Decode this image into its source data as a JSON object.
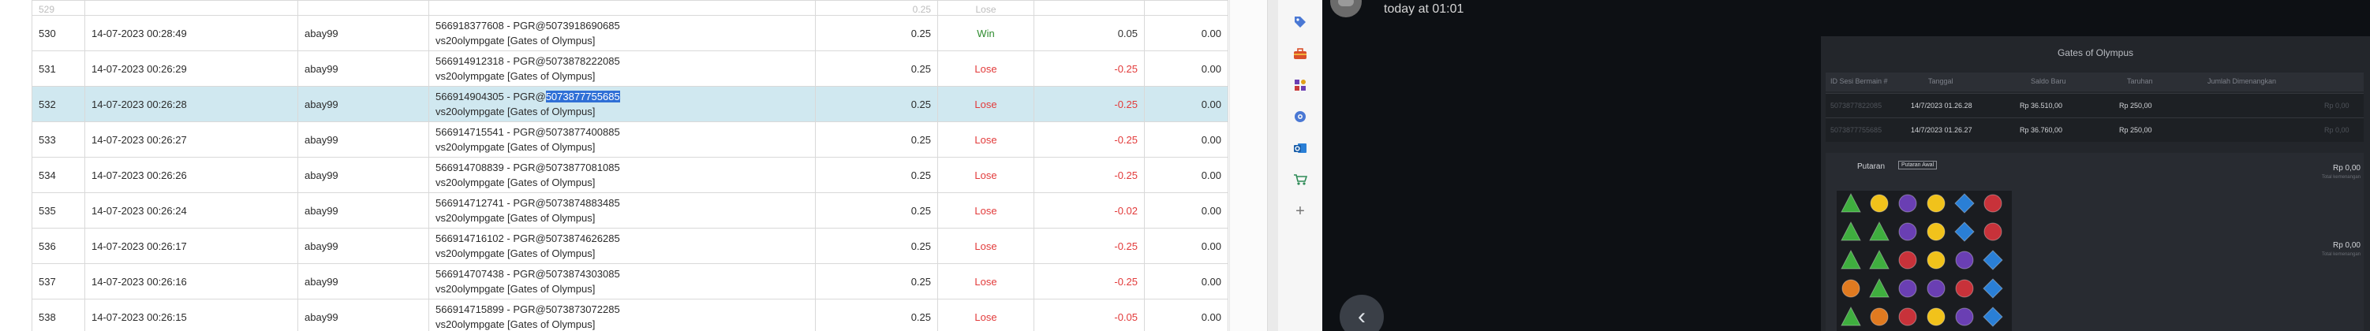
{
  "table": {
    "partial_row": {
      "no": "529",
      "date": "",
      "user": "",
      "amount": "0.25",
      "result": "Lose",
      "winloss": "",
      "bal": ""
    },
    "rows": [
      {
        "no": "530",
        "date": "14-07-2023 00:28:49",
        "user": "abay99",
        "tx1": "566918377608 - PGR@5073918690685",
        "tx2": "vs20olympgate [Gates of Olympus]",
        "amount": "0.25",
        "result": "Win",
        "winloss": "0.05",
        "bal": "0.00"
      },
      {
        "no": "531",
        "date": "14-07-2023 00:26:29",
        "user": "abay99",
        "tx1": "566914912318 - PGR@5073878222085",
        "tx2": "vs20olympgate [Gates of Olympus]",
        "amount": "0.25",
        "result": "Lose",
        "winloss": "-0.25",
        "bal": "0.00"
      },
      {
        "no": "532",
        "date": "14-07-2023 00:26:28",
        "user": "abay99",
        "tx1_prefix": "566914904305 - PGR@",
        "tx1_highlight": "5073877755685",
        "tx2": "vs20olympgate [Gates of Olympus]",
        "amount": "0.25",
        "result": "Lose",
        "winloss": "-0.25",
        "bal": "0.00"
      },
      {
        "no": "533",
        "date": "14-07-2023 00:26:27",
        "user": "abay99",
        "tx1": "566914715541 - PGR@5073877400885",
        "tx2": "vs20olympgate [Gates of Olympus]",
        "amount": "0.25",
        "result": "Lose",
        "winloss": "-0.25",
        "bal": "0.00"
      },
      {
        "no": "534",
        "date": "14-07-2023 00:26:26",
        "user": "abay99",
        "tx1": "566914708839 - PGR@5073877081085",
        "tx2": "vs20olympgate [Gates of Olympus]",
        "amount": "0.25",
        "result": "Lose",
        "winloss": "-0.25",
        "bal": "0.00"
      },
      {
        "no": "535",
        "date": "14-07-2023 00:26:24",
        "user": "abay99",
        "tx1": "566914712741 - PGR@5073874883485",
        "tx2": "vs20olympgate [Gates of Olympus]",
        "amount": "0.25",
        "result": "Lose",
        "winloss": "-0.02",
        "bal": "0.00"
      },
      {
        "no": "536",
        "date": "14-07-2023 00:26:17",
        "user": "abay99",
        "tx1": "566914716102 - PGR@5073874626285",
        "tx2": "vs20olympgate [Gates of Olympus]",
        "amount": "0.25",
        "result": "Lose",
        "winloss": "-0.25",
        "bal": "0.00"
      },
      {
        "no": "537",
        "date": "14-07-2023 00:26:16",
        "user": "abay99",
        "tx1": "566914707438 - PGR@5073874303085",
        "tx2": "vs20olympgate [Gates of Olympus]",
        "amount": "0.25",
        "result": "Lose",
        "winloss": "-0.25",
        "bal": "0.00"
      },
      {
        "no": "538",
        "date": "14-07-2023 00:26:15",
        "user": "abay99",
        "tx1": "566914715899 - PGR@5073873072285",
        "tx2": "vs20olympgate [Gates of Olympus]",
        "amount": "0.25",
        "result": "Lose",
        "winloss": "-0.05",
        "bal": "0.00"
      }
    ]
  },
  "rail": {
    "icons": [
      "tag-icon",
      "toolbox-icon",
      "chess-icon",
      "extension-icon",
      "outlook-icon",
      "cart-icon",
      "plus-icon"
    ],
    "plus_label": "+"
  },
  "chat": {
    "timestamp": "today at 01:01",
    "back_glyph": "‹"
  },
  "game": {
    "title": "Gates of Olympus",
    "headers": [
      "ID Sesi Bermain #",
      "Tanggal",
      "Saldo Baru",
      "Taruhan",
      "Jumlah Dimenangkan"
    ],
    "rows": [
      {
        "id": "5073877822085",
        "date": "14/7/2023 01.26.28",
        "balance": "Rp 36.510,00",
        "bet": "Rp 250,00",
        "won": "Rp 0,00"
      },
      {
        "id": "5073877755685",
        "date": "14/7/2023 01.26.27",
        "balance": "Rp 36.760,00",
        "bet": "Rp 250,00",
        "won": "Rp 0,00"
      }
    ],
    "spin_label": "Putaran",
    "spin_badge": "Putaran Awal",
    "win_top": "Rp 0,00",
    "win_top_sub": "Total kemenangan",
    "win_bottom": "Rp 0,00",
    "win_bottom_sub": "Total kemenangan",
    "colors": {
      "green": "#3fae3f",
      "yellow": "#f1c21b",
      "purple": "#6a3fb3",
      "blue": "#2a7fd6",
      "red": "#c8323a",
      "orange": "#e07a20"
    }
  }
}
